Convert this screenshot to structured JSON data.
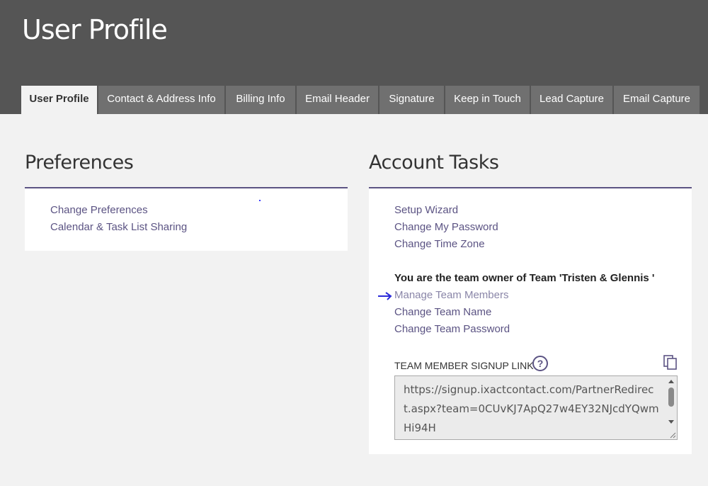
{
  "header": {
    "title": "User Profile"
  },
  "tabs": [
    {
      "label": "User Profile",
      "active": true
    },
    {
      "label": "Contact & Address Info"
    },
    {
      "label": "Billing Info"
    },
    {
      "label": "Email Header"
    },
    {
      "label": "Signature"
    },
    {
      "label": "Keep in Touch"
    },
    {
      "label": "Lead Capture"
    },
    {
      "label": "Email Capture"
    }
  ],
  "preferences": {
    "title": "Preferences",
    "links": [
      "Change Preferences",
      "Calendar & Task List Sharing"
    ]
  },
  "account_tasks": {
    "title": "Account Tasks",
    "links": [
      "Setup Wizard",
      "Change My Password",
      "Change Time Zone"
    ],
    "team_owner_text": "You are the team owner of Team 'Tristen & Glennis '",
    "team_links": [
      "Manage Team Members",
      "Change Team Name",
      "Change Team Password"
    ],
    "signup_label": "TEAM MEMBER SIGNUP LINK",
    "signup_link": "https://signup.ixactcontact.com/PartnerRedirect.aspx?team=0CUvKJ7ApQ27w4EY32NJcdYQwmHi94H"
  },
  "icons": {
    "help": "help-icon",
    "copy": "copy-icon",
    "pointer": "arrow-right-icon"
  },
  "colors": {
    "accent": "#5b5383",
    "header_bg": "#555555",
    "tab_bg": "#707070"
  }
}
